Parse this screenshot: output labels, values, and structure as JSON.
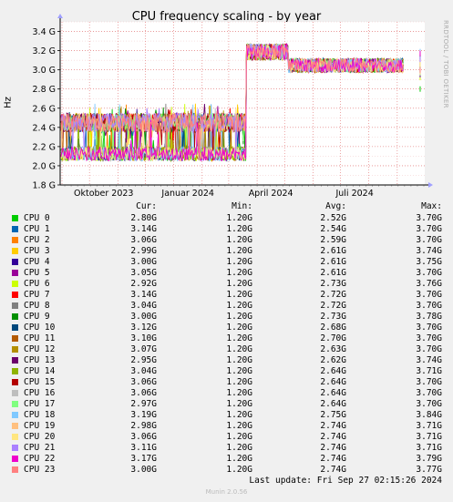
{
  "title": "CPU frequency scaling - by year",
  "side_text": "RRDTOOL / TOBI OETIKER",
  "footer": "Last update: Fri Sep 27 02:15:26 2024",
  "munin": "Munin 2.0.56",
  "legend_headers": {
    "cur": "Cur:",
    "min": "Min:",
    "avg": "Avg:",
    "max": "Max:"
  },
  "chart_data": {
    "type": "line",
    "title": "CPU frequency scaling - by year",
    "ylabel": "Hz",
    "ylim": [
      1.8,
      3.5
    ],
    "y_unit": "G",
    "y_ticks": [
      "1.8 G",
      "2.0 G",
      "2.2 G",
      "2.4 G",
      "2.6 G",
      "2.8 G",
      "3.0 G",
      "3.2 G",
      "3.4 G"
    ],
    "x_range": [
      "2023-08-30",
      "2024-10-01"
    ],
    "x_ticks": [
      "Oktober 2023",
      "Januar 2024",
      "April 2024",
      "Juli 2024"
    ],
    "grid": true,
    "regimes": [
      {
        "from": "2023-08-31",
        "to": "2024-03-20",
        "lower_band": [
          2.05,
          2.2
        ],
        "upper_band": [
          2.35,
          2.55
        ]
      },
      {
        "from": "2024-03-20",
        "to": "2024-05-05",
        "band": [
          3.1,
          3.27
        ]
      },
      {
        "from": "2024-05-05",
        "to": "2024-09-08",
        "band": [
          2.97,
          3.12
        ]
      }
    ],
    "series": [
      {
        "name": "CPU 0",
        "color": "#00cc00",
        "cur": "2.80G",
        "min": "1.20G",
        "avg": "2.52G",
        "max": "3.70G"
      },
      {
        "name": "CPU 1",
        "color": "#0066b3",
        "cur": "3.14G",
        "min": "1.20G",
        "avg": "2.54G",
        "max": "3.70G"
      },
      {
        "name": "CPU 2",
        "color": "#ff8000",
        "cur": "3.06G",
        "min": "1.20G",
        "avg": "2.59G",
        "max": "3.70G"
      },
      {
        "name": "CPU 3",
        "color": "#ffcc00",
        "cur": "2.99G",
        "min": "1.20G",
        "avg": "2.61G",
        "max": "3.74G"
      },
      {
        "name": "CPU 4",
        "color": "#330099",
        "cur": "3.00G",
        "min": "1.20G",
        "avg": "2.61G",
        "max": "3.75G"
      },
      {
        "name": "CPU 5",
        "color": "#990099",
        "cur": "3.05G",
        "min": "1.20G",
        "avg": "2.61G",
        "max": "3.70G"
      },
      {
        "name": "CPU 6",
        "color": "#ccff00",
        "cur": "2.92G",
        "min": "1.20G",
        "avg": "2.73G",
        "max": "3.76G"
      },
      {
        "name": "CPU 7",
        "color": "#ff0000",
        "cur": "3.14G",
        "min": "1.20G",
        "avg": "2.72G",
        "max": "3.70G"
      },
      {
        "name": "CPU 8",
        "color": "#808080",
        "cur": "3.04G",
        "min": "1.20G",
        "avg": "2.72G",
        "max": "3.70G"
      },
      {
        "name": "CPU 9",
        "color": "#008f00",
        "cur": "3.00G",
        "min": "1.20G",
        "avg": "2.73G",
        "max": "3.78G"
      },
      {
        "name": "CPU 10",
        "color": "#00487d",
        "cur": "3.12G",
        "min": "1.20G",
        "avg": "2.68G",
        "max": "3.70G"
      },
      {
        "name": "CPU 11",
        "color": "#b35a00",
        "cur": "3.10G",
        "min": "1.20G",
        "avg": "2.70G",
        "max": "3.70G"
      },
      {
        "name": "CPU 12",
        "color": "#b38f00",
        "cur": "3.07G",
        "min": "1.20G",
        "avg": "2.63G",
        "max": "3.70G"
      },
      {
        "name": "CPU 13",
        "color": "#6b006b",
        "cur": "2.95G",
        "min": "1.20G",
        "avg": "2.62G",
        "max": "3.74G"
      },
      {
        "name": "CPU 14",
        "color": "#8fb300",
        "cur": "3.04G",
        "min": "1.20G",
        "avg": "2.64G",
        "max": "3.71G"
      },
      {
        "name": "CPU 15",
        "color": "#b30000",
        "cur": "3.06G",
        "min": "1.20G",
        "avg": "2.64G",
        "max": "3.70G"
      },
      {
        "name": "CPU 16",
        "color": "#bebebe",
        "cur": "3.06G",
        "min": "1.20G",
        "avg": "2.64G",
        "max": "3.70G"
      },
      {
        "name": "CPU 17",
        "color": "#80ff80",
        "cur": "2.97G",
        "min": "1.20G",
        "avg": "2.64G",
        "max": "3.70G"
      },
      {
        "name": "CPU 18",
        "color": "#80c9ff",
        "cur": "3.19G",
        "min": "1.20G",
        "avg": "2.75G",
        "max": "3.84G"
      },
      {
        "name": "CPU 19",
        "color": "#ffc080",
        "cur": "2.98G",
        "min": "1.20G",
        "avg": "2.74G",
        "max": "3.71G"
      },
      {
        "name": "CPU 20",
        "color": "#ffe680",
        "cur": "3.06G",
        "min": "1.20G",
        "avg": "2.74G",
        "max": "3.71G"
      },
      {
        "name": "CPU 21",
        "color": "#aa80ff",
        "cur": "3.11G",
        "min": "1.20G",
        "avg": "2.74G",
        "max": "3.71G"
      },
      {
        "name": "CPU 22",
        "color": "#ee00cc",
        "cur": "3.17G",
        "min": "1.20G",
        "avg": "2.74G",
        "max": "3.79G"
      },
      {
        "name": "CPU 23",
        "color": "#ff8080",
        "cur": "3.00G",
        "min": "1.20G",
        "avg": "2.74G",
        "max": "3.77G"
      }
    ]
  }
}
